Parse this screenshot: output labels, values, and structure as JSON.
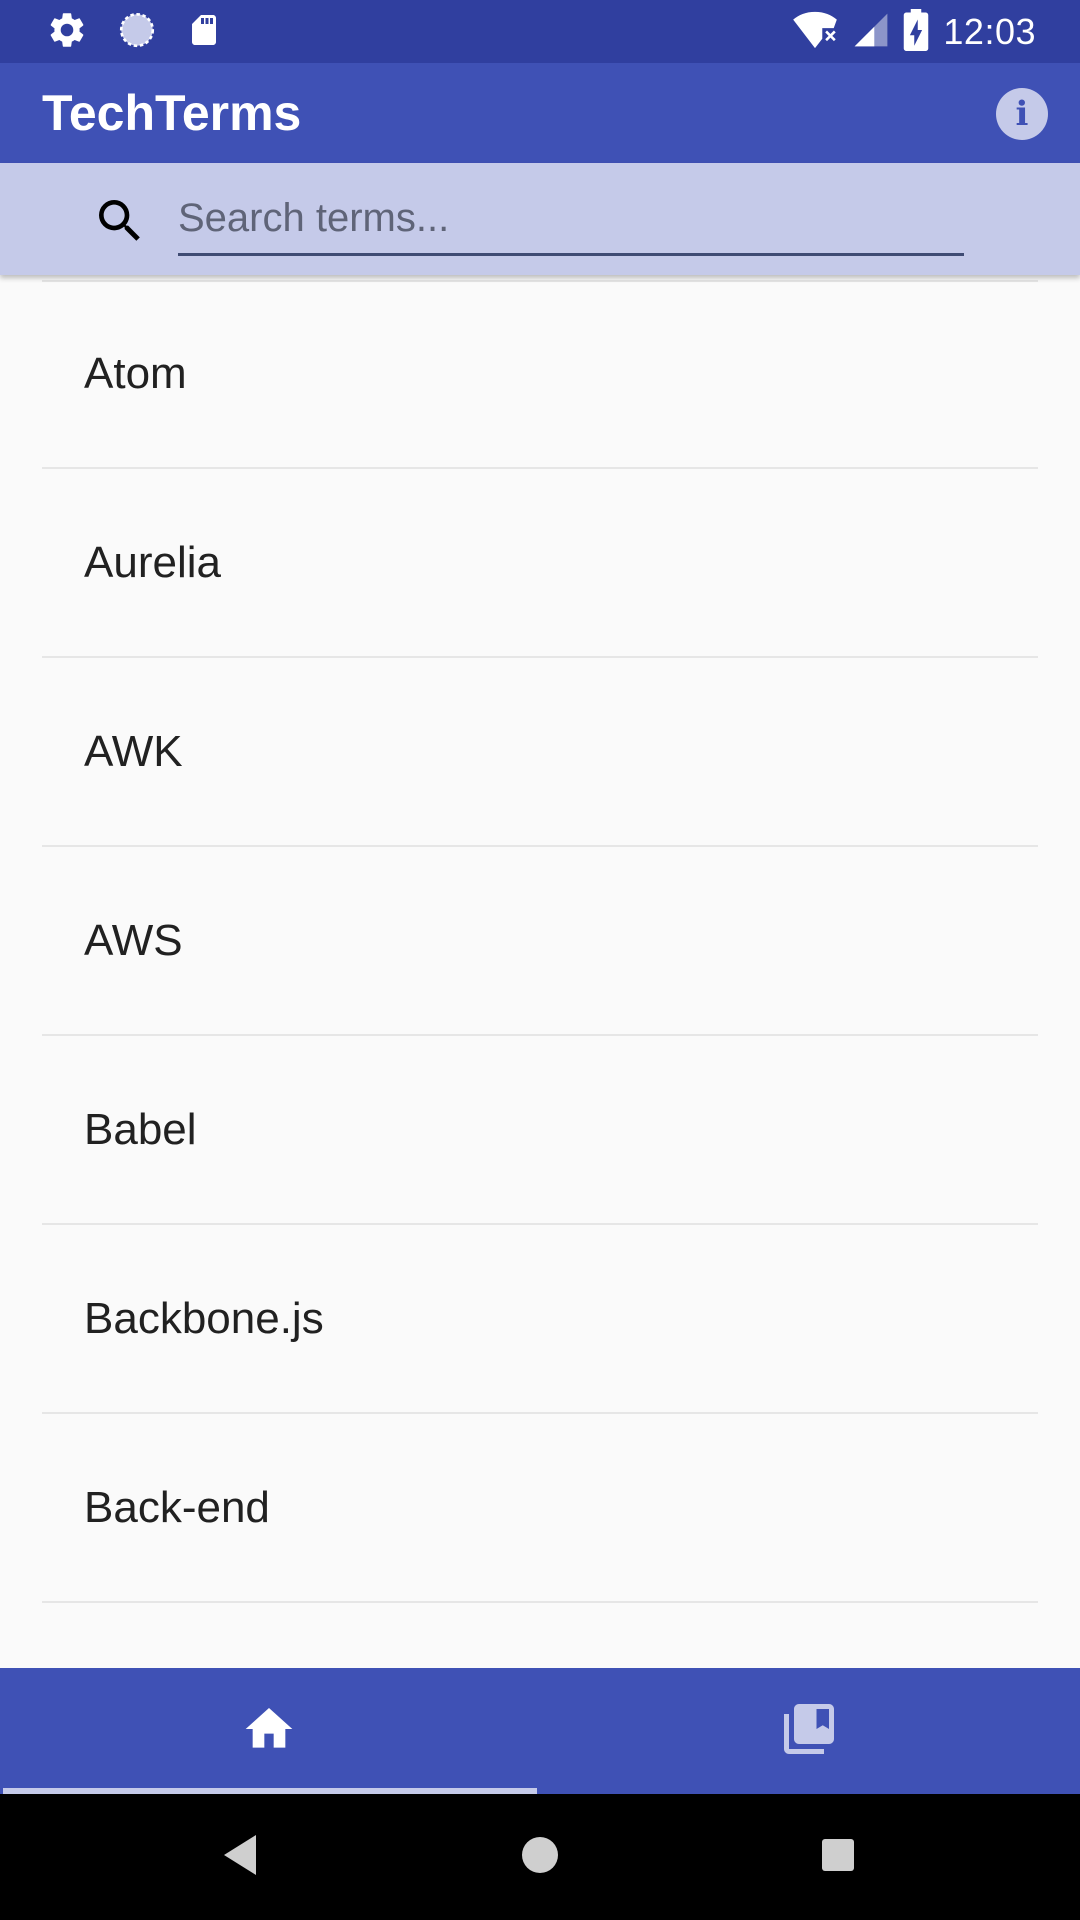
{
  "status_bar": {
    "time": "12:03",
    "left_icons": [
      "gear-icon",
      "sync-icon",
      "sd-card-icon"
    ],
    "right_icons": [
      "wifi-off-icon",
      "signal-icon",
      "battery-charging-icon"
    ]
  },
  "app_bar": {
    "title": "TechTerms",
    "info_icon": "info-icon"
  },
  "search": {
    "placeholder": "Search terms...",
    "value": "",
    "icon": "search-icon"
  },
  "terms": [
    {
      "label": "Atom"
    },
    {
      "label": "Aurelia"
    },
    {
      "label": "AWK"
    },
    {
      "label": "AWS"
    },
    {
      "label": "Babel"
    },
    {
      "label": "Backbone.js"
    },
    {
      "label": "Back-end"
    }
  ],
  "bottom_nav": {
    "tabs": [
      {
        "icon": "home-icon",
        "selected": true
      },
      {
        "icon": "bookmarks-icon",
        "selected": false
      }
    ]
  },
  "system_nav": {
    "buttons": [
      "back-icon",
      "home-circle-icon",
      "recents-icon"
    ]
  },
  "colors": {
    "primary": "#3f51b5",
    "primary_dark": "#303f9f",
    "primary_light": "#c5cae9",
    "text": "#212121",
    "background": "#fafafa"
  }
}
